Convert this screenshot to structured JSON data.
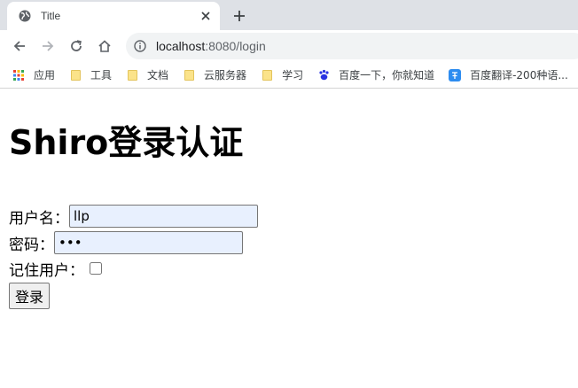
{
  "browser": {
    "tab": {
      "title": "Title"
    },
    "url": {
      "host": "localhost",
      "rest": ":8080/login"
    },
    "bookmarks": [
      {
        "label": "应用",
        "icon": "apps-grid-icon"
      },
      {
        "label": "工具",
        "icon": "folder-icon"
      },
      {
        "label": "文档",
        "icon": "folder-icon"
      },
      {
        "label": "云服务器",
        "icon": "folder-icon"
      },
      {
        "label": "学习",
        "icon": "folder-icon"
      },
      {
        "label": "百度一下，你就知道",
        "icon": "baidu-paw-icon"
      },
      {
        "label": "百度翻译-200种语...",
        "icon": "baidu-translate-icon"
      }
    ]
  },
  "page": {
    "heading": "Shiro登录认证",
    "form": {
      "username_label": "用户名：",
      "username_value": "llp",
      "password_label": "密码：",
      "password_value": "123",
      "remember_label": "记住用户：",
      "remember_checked": false,
      "submit_label": "登录"
    }
  }
}
